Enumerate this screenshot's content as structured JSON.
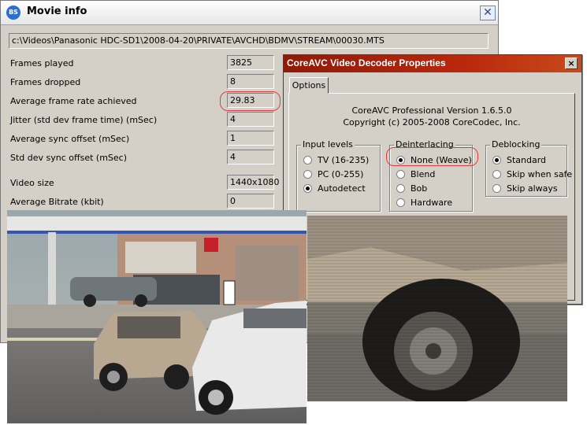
{
  "movie_info": {
    "title": "Movie info",
    "logo_text": "BS",
    "path": "c:\\Videos\\Panasonic HDC-SD1\\2008-04-20\\PRIVATE\\AVCHD\\BDMV\\STREAM\\00030.MTS",
    "rows": [
      {
        "label": "Frames played",
        "value": "3825"
      },
      {
        "label": "Frames dropped",
        "value": "8"
      },
      {
        "label": "Average frame rate achieved",
        "value": "29.83"
      },
      {
        "label": "Jitter (std dev frame time) (mSec)",
        "value": "4"
      },
      {
        "label": "Average sync offset (mSec)",
        "value": "1"
      },
      {
        "label": "Std dev sync offset (mSec)",
        "value": "4"
      },
      {
        "label": "Video size",
        "value": "1440x1080"
      },
      {
        "label": "Average Bitrate (kbit)",
        "value": "0"
      }
    ]
  },
  "coreavc": {
    "title": "CoreAVC Video Decoder Properties",
    "tab": "Options",
    "version": "CoreAVC Professional Version 1.6.5.0",
    "copyright": "Copyright (c) 2005-2008 CoreCodec, Inc.",
    "input_levels": {
      "title": "Input levels",
      "options": [
        "TV (16-235)",
        "PC (0-255)",
        "Autodetect"
      ],
      "selected": "Autodetect"
    },
    "deinterlacing": {
      "title": "Deinterlacing",
      "options": [
        "None (Weave)",
        "Blend",
        "Bob",
        "Hardware"
      ],
      "selected": "None (Weave)"
    },
    "deblocking": {
      "title": "Deblocking",
      "options": [
        "Standard",
        "Skip when safe",
        "Skip always"
      ],
      "selected": "Standard"
    }
  },
  "colors": {
    "annotation_red": "#e33c3c",
    "coreavc_titlebar": "#b9280c"
  }
}
